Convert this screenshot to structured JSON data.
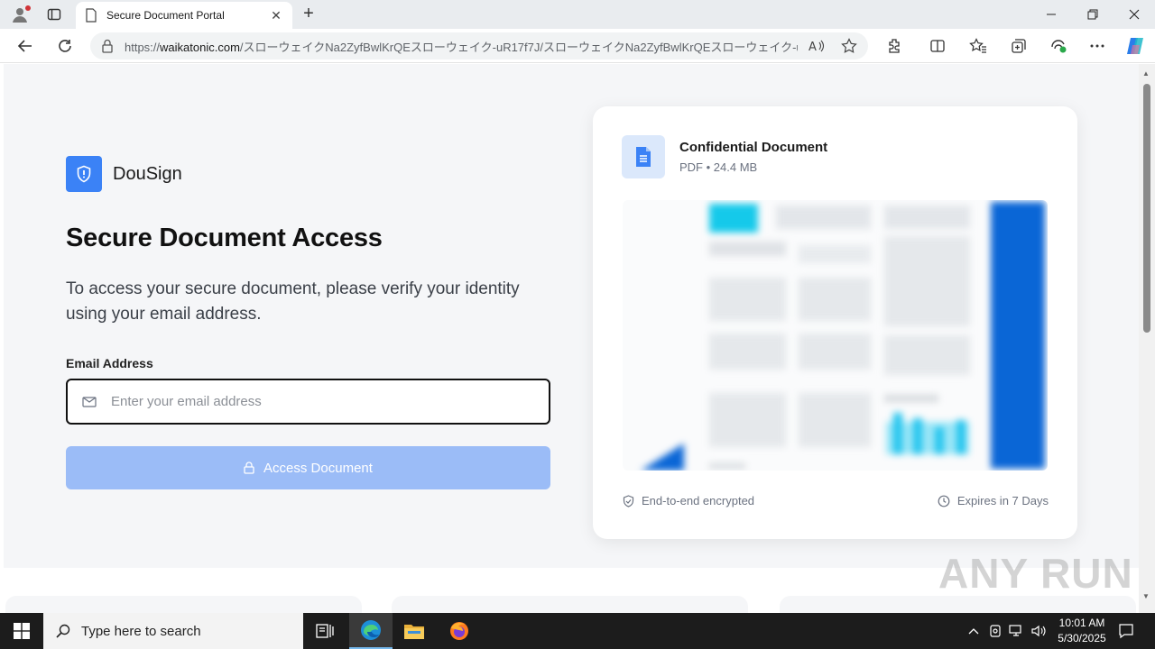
{
  "browser": {
    "tab_title": "Secure Document Portal",
    "url_prefix": "https://",
    "url_domain": "waikatonic.com",
    "url_path": "/スローウェイクNa2ZyfBwlKrQEスローウェイク-uR17f7J/スローウェイクNa2ZyfBwlKrQEスローウェイク-uR17f..."
  },
  "brand": {
    "name": "DouSign",
    "color": "#3b82f6"
  },
  "main": {
    "title": "Secure Document Access",
    "description": "To access your secure document, please verify your identity using your email address.",
    "email_label": "Email Address",
    "email_placeholder": "Enter your email address",
    "email_value": "",
    "button_label": "Access Document"
  },
  "document": {
    "name": "Confidential Document",
    "meta": "PDF • 24.4 MB",
    "encryption": "End-to-end encrypted",
    "expiry": "Expires in 7 Days"
  },
  "watermark": "ANY RUN",
  "taskbar": {
    "search_placeholder": "Type here to search",
    "time": "10:01 AM",
    "date": "5/30/2025"
  },
  "colors": {
    "accent": "#3b82f6",
    "button_disabled": "#9bbcf7",
    "doc_icon_bg": "#dbe8fb"
  }
}
